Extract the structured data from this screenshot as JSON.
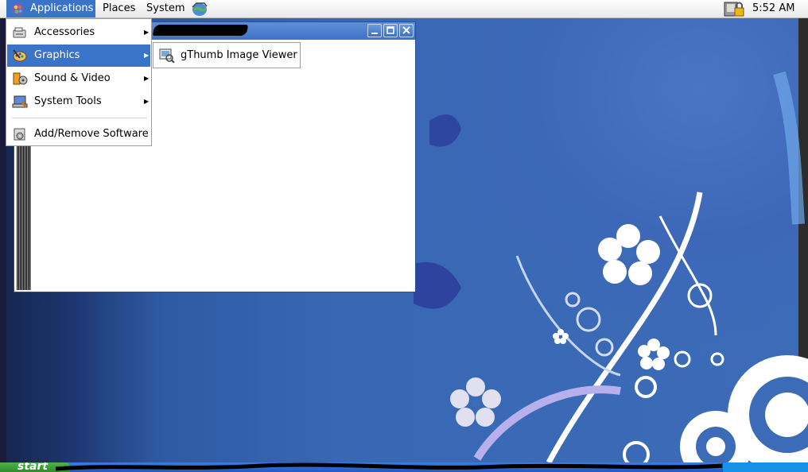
{
  "top_panel": {
    "menus": {
      "applications": "Applications",
      "places": "Places",
      "system": "System"
    },
    "icons": {
      "applications": "gnome-foot-icon",
      "browser_launcher": "web-browser-icon",
      "lock": "screen-lock-icon"
    },
    "clock": "5:52 AM"
  },
  "applications_menu": {
    "items": [
      {
        "label": "Accessories",
        "icon": "accessories-icon",
        "submenu": true
      },
      {
        "label": "Graphics",
        "icon": "graphics-icon",
        "submenu": true,
        "highlighted": true
      },
      {
        "label": "Sound & Video",
        "icon": "sound-video-icon",
        "submenu": true
      },
      {
        "label": "System Tools",
        "icon": "system-tools-icon",
        "submenu": true
      },
      {
        "label": "Add/Remove Software",
        "icon": "add-remove-software-icon",
        "submenu": false
      }
    ],
    "submenu_arrow": "▶"
  },
  "graphics_submenu": {
    "items": [
      {
        "label": "gThumb Image Viewer",
        "icon": "gthumb-icon"
      }
    ]
  },
  "app_window": {
    "buttons": [
      "minimize-icon",
      "maximize-icon",
      "close-icon"
    ]
  },
  "taskbar": {
    "start_label": "start"
  },
  "colors": {
    "menu_highlight": "#3a74c8",
    "window_titlebar": "#4a7ccc",
    "desktop_blue": "#3c6cb8",
    "taskbar_blue": "#2458c8",
    "start_green": "#3a9d36"
  }
}
